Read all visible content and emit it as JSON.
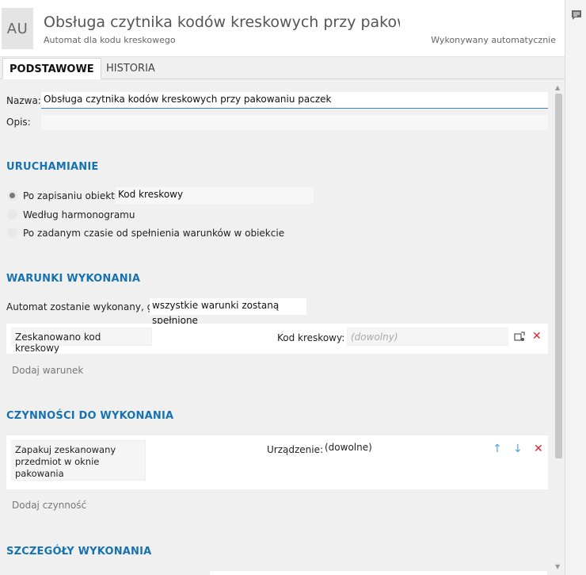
{
  "header": {
    "avatar": "AU",
    "title": "Obsługa czytnika kodów kreskowych przy pakow...",
    "subtitle": "Automat dla kodu kreskowego",
    "mode": "Wykonywany automatycznie"
  },
  "tabs": [
    {
      "label": "PODSTAWOWE",
      "active": true
    },
    {
      "label": "HISTORIA",
      "active": false
    }
  ],
  "form": {
    "name_label": "Nazwa:",
    "name_value": "Obsługa czytnika kodów kreskowych przy pakowaniu paczek",
    "desc_label": "Opis:",
    "desc_value": ""
  },
  "launch": {
    "heading": "URUCHAMIANIE",
    "options": [
      {
        "label": "Po zapisaniu obiektu",
        "checked": true,
        "value": "Kod kreskowy"
      },
      {
        "label": "Według harmonogramu",
        "checked": false
      },
      {
        "label": "Po zadanym czasie od spełnienia warunków w obiekcie",
        "checked": false
      }
    ]
  },
  "conditions": {
    "heading": "WARUNKI WYKONANIA",
    "intro": "Automat zostanie wykonany, gdy",
    "mode": "wszystkie warunki zostaną spełnione",
    "items": [
      {
        "name": "Zeskanowano kod kreskowy",
        "field_label": "Kod kreskowy:",
        "field_placeholder": "(dowolny)"
      }
    ],
    "add_label": "Dodaj warunek"
  },
  "actions": {
    "heading": "CZYNNOŚCI DO WYKONANIA",
    "items": [
      {
        "name": "Zapakuj zeskanowany przedmiot w oknie pakowania",
        "field_label": "Urządzenie:",
        "field_value": "(dowolne)"
      }
    ],
    "add_label": "Dodaj czynność"
  },
  "details": {
    "heading": "SZCZEGÓŁY WYKONANIA"
  },
  "colors": {
    "accent": "#1773b0",
    "delete": "#e0212d",
    "arrow": "#4aa5d8"
  }
}
